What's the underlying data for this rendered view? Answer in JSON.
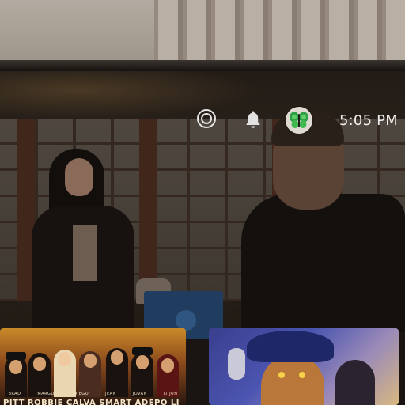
{
  "status_bar": {
    "time": "5:05 PM",
    "icons": [
      "target-icon",
      "bell-icon",
      "butterfly-avatar"
    ],
    "avatar_color": "#4caf50"
  },
  "rows": [
    {
      "tiles": [
        {
          "credits_names": [
            "BRAD",
            "MARGOT",
            "DIEGO",
            "JEAN",
            "JOVAN",
            "LI JUN"
          ],
          "credits_surnames": "PITT ROBBIE CALVA SMART ADEPO LI"
        },
        {
          "credits_names": [],
          "credits_surnames": ""
        }
      ]
    }
  ]
}
